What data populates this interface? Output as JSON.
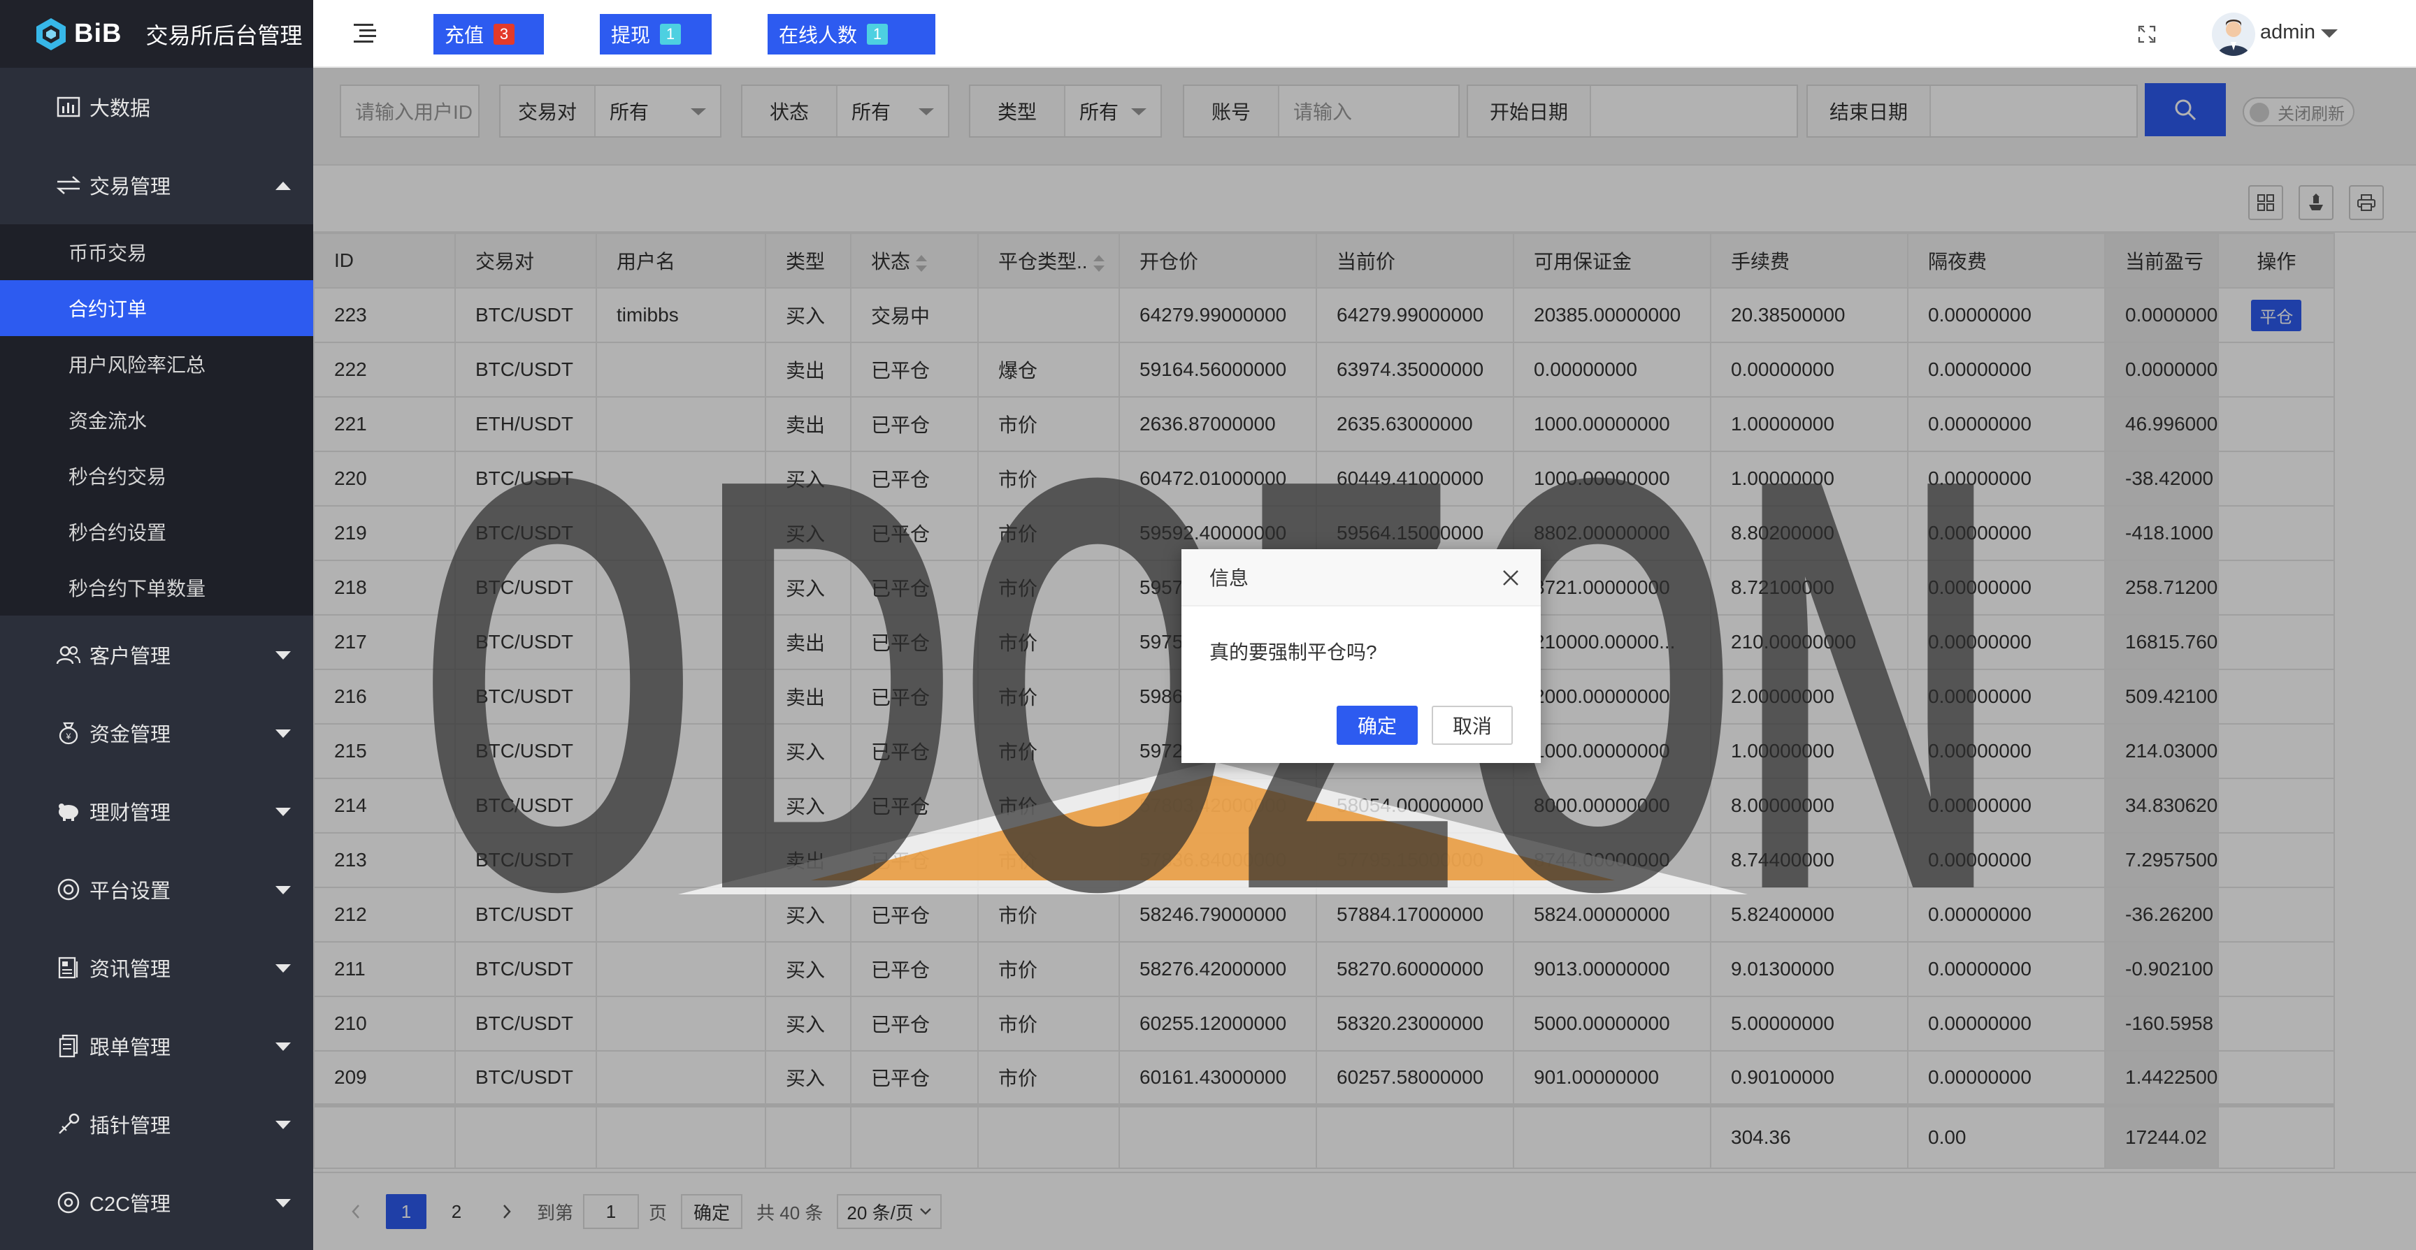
{
  "brand": {
    "logo_text": "BiB",
    "title": "交易所后台管理"
  },
  "sidebar": {
    "top_items": [
      {
        "label": "大数据",
        "icon": "bar-chart-icon"
      }
    ],
    "trade": {
      "label": "交易管理",
      "icon": "exchange-arrows-icon",
      "sub_items": [
        "币币交易",
        "合约订单",
        "用户风险率汇总",
        "资金流水",
        "秒合约交易",
        "秒合约设置",
        "秒合约下单数量"
      ],
      "active_index": 1
    },
    "bottom_items": [
      {
        "label": "客户管理",
        "icon": "users-icon"
      },
      {
        "label": "资金管理",
        "icon": "money-bag-icon"
      },
      {
        "label": "理财管理",
        "icon": "piggy-bank-icon"
      },
      {
        "label": "平台设置",
        "icon": "settings-icon"
      },
      {
        "label": "资讯管理",
        "icon": "news-icon"
      },
      {
        "label": "跟单管理",
        "icon": "document-icon"
      },
      {
        "label": "插针管理",
        "icon": "needle-icon"
      },
      {
        "label": "C2C管理",
        "icon": "c2c-icon"
      }
    ]
  },
  "header": {
    "recharge": {
      "label": "充值",
      "count": "3"
    },
    "withdraw": {
      "label": "提现",
      "count": "1"
    },
    "online": {
      "label": "在线人数",
      "count": "1"
    },
    "username": "admin"
  },
  "filters": {
    "user_id_placeholder": "请输入用户ID",
    "pair_label": "交易对",
    "pair_value": "所有",
    "status_label": "状态",
    "status_value": "所有",
    "type_label": "类型",
    "type_value": "所有",
    "account_label": "账号",
    "account_placeholder": "请输入",
    "start_label": "开始日期",
    "end_label": "结束日期",
    "refresh_label": "关闭刷新"
  },
  "table": {
    "columns": [
      "ID",
      "交易对",
      "用户名",
      "类型",
      "状态",
      "平仓类型..",
      "开仓价",
      "当前价",
      "可用保证金",
      "手续费",
      "隔夜费",
      "当前盈亏",
      "操作"
    ],
    "rows": [
      [
        "223",
        "BTC/USDT",
        "timibbs",
        "买入",
        "交易中",
        "",
        "64279.99000000",
        "64279.99000000",
        "20385.00000000",
        "20.38500000",
        "0.00000000",
        "0.0000000",
        "平仓"
      ],
      [
        "222",
        "BTC/USDT",
        "",
        "卖出",
        "已平仓",
        "爆仓",
        "59164.56000000",
        "63974.35000000",
        "0.00000000",
        "0.00000000",
        "0.00000000",
        "0.0000000",
        ""
      ],
      [
        "221",
        "ETH/USDT",
        "",
        "卖出",
        "已平仓",
        "市价",
        "2636.87000000",
        "2635.63000000",
        "1000.00000000",
        "1.00000000",
        "0.00000000",
        "46.996000",
        ""
      ],
      [
        "220",
        "BTC/USDT",
        "",
        "买入",
        "已平仓",
        "市价",
        "60472.01000000",
        "60449.41000000",
        "1000.00000000",
        "1.00000000",
        "0.00000000",
        "-38.42000",
        ""
      ],
      [
        "219",
        "BTC/USDT",
        "",
        "买入",
        "已平仓",
        "市价",
        "59592.40000000",
        "59564.15000000",
        "8802.00000000",
        "8.80200000",
        "0.00000000",
        "-418.1000",
        ""
      ],
      [
        "218",
        "BTC/USDT",
        "",
        "买入",
        "已平仓",
        "市价",
        "5957",
        "",
        "8721.00000000",
        "8.72100000",
        "0.00000000",
        "258.71200",
        ""
      ],
      [
        "217",
        "BTC/USDT",
        "",
        "卖出",
        "已平仓",
        "市价",
        "5975",
        "",
        "210000.00000...",
        "210.00000000",
        "0.00000000",
        "16815.760",
        ""
      ],
      [
        "216",
        "BTC/USDT",
        "",
        "卖出",
        "已平仓",
        "市价",
        "5986",
        "",
        "2000.00000000",
        "2.00000000",
        "0.00000000",
        "509.42100",
        ""
      ],
      [
        "215",
        "BTC/USDT",
        "",
        "买入",
        "已平仓",
        "市价",
        "5972",
        "",
        "1000.00000000",
        "1.00000000",
        "0.00000000",
        "214.03000",
        ""
      ],
      [
        "214",
        "BTC/USDT",
        "",
        "买入",
        "已平仓",
        "市价",
        "57803.42000000",
        "58054.00000000",
        "8000.00000000",
        "8.00000000",
        "0.00000000",
        "34.830620",
        ""
      ],
      [
        "213",
        "BTC/USDT",
        "",
        "卖出",
        "已平仓",
        "市价",
        "57836.84000000",
        "57795.15000000",
        "8744.00000000",
        "8.74400000",
        "0.00000000",
        "7.2957500",
        ""
      ],
      [
        "212",
        "BTC/USDT",
        "",
        "买入",
        "已平仓",
        "市价",
        "58246.79000000",
        "57884.17000000",
        "5824.00000000",
        "5.82400000",
        "0.00000000",
        "-36.26200",
        ""
      ],
      [
        "211",
        "BTC/USDT",
        "",
        "买入",
        "已平仓",
        "市价",
        "58276.42000000",
        "58270.60000000",
        "9013.00000000",
        "9.01300000",
        "0.00000000",
        "-0.902100",
        ""
      ],
      [
        "210",
        "BTC/USDT",
        "",
        "买入",
        "已平仓",
        "市价",
        "60255.12000000",
        "58320.23000000",
        "5000.00000000",
        "5.00000000",
        "0.00000000",
        "-160.5958",
        ""
      ],
      [
        "209",
        "BTC/USDT",
        "",
        "买入",
        "已平仓",
        "市价",
        "60161.43000000",
        "60257.58000000",
        "901.00000000",
        "0.90100000",
        "0.00000000",
        "1.4422500",
        ""
      ]
    ],
    "totals": {
      "fee": "304.36",
      "overnight": "0.00",
      "pnl": "17244.02"
    }
  },
  "pager": {
    "pages": [
      "1",
      "2"
    ],
    "goto_label": "到第",
    "goto_value": "1",
    "page_unit": "页",
    "confirm": "确定",
    "total": "共 40 条",
    "page_size": "20 条/页"
  },
  "dialog": {
    "title": "信息",
    "message": "真的要强制平仓吗?",
    "ok": "确定",
    "cancel": "取消"
  },
  "watermark": {
    "text": "ODOZON"
  },
  "colors": {
    "accent": "#2d5bf0",
    "sidebar_bg": "#2b2f3a",
    "badge_red": "#e33a2a",
    "badge_cyan": "#4dd0e1",
    "watermark_orange": "#e8922c"
  }
}
